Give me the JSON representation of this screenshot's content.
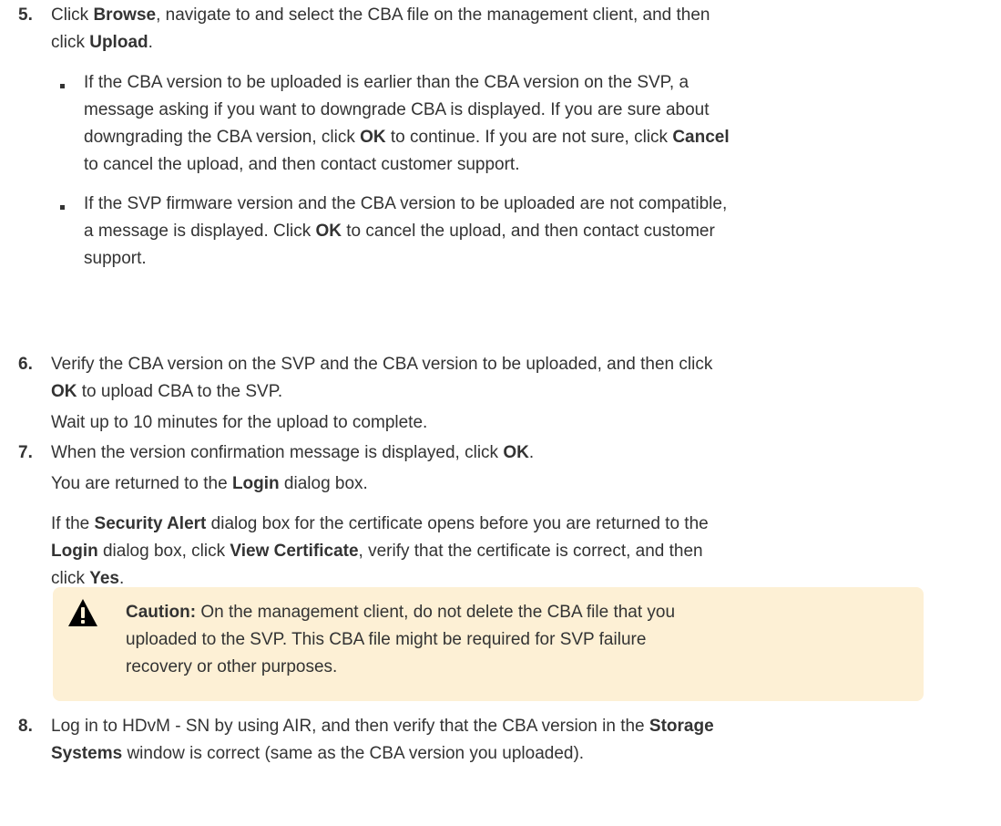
{
  "steps": [
    {
      "number": "5.",
      "lines": [
        [
          "Click ",
          {
            "b": "Browse"
          },
          ", navigate to and select the CBA file on the management client, and then"
        ],
        [
          "click ",
          {
            "b": "Upload"
          },
          "."
        ]
      ],
      "bullets": [
        [
          [
            "If the CBA version to be uploaded is earlier than the CBA version on the SVP, a"
          ],
          [
            "message asking if you want to downgrade CBA is displayed. If you are sure about"
          ],
          [
            "downgrading the CBA version, click ",
            {
              "b": "OK"
            },
            " to continue. If you are not sure, click ",
            {
              "b": "Cancel"
            }
          ],
          [
            "to cancel the upload, and then contact customer support."
          ]
        ],
        [
          [
            "If the SVP firmware version and the CBA version to be uploaded are not compatible,"
          ],
          [
            "a message is displayed. Click ",
            {
              "b": "OK"
            },
            " to cancel the upload, and then contact customer"
          ],
          [
            "support."
          ]
        ]
      ]
    },
    {
      "number": "6.",
      "lines": [
        [
          "Verify the CBA version on the SVP and the CBA version to be uploaded, and then click"
        ],
        [
          {
            "b": "OK"
          },
          " to upload CBA to the SVP."
        ]
      ],
      "note_lines": [
        [
          "Wait up to 10 minutes for the upload to complete."
        ]
      ]
    },
    {
      "number": "7.",
      "lines": [
        [
          "When the version confirmation message is displayed, click ",
          {
            "b": "OK"
          },
          "."
        ]
      ],
      "note_lines": [
        [
          "You are returned to the ",
          {
            "b": "Login"
          },
          " dialog box."
        ]
      ],
      "para_lines": [
        [
          "If the ",
          {
            "b": "Security Alert"
          },
          " dialog box for the certificate opens before you are returned to the"
        ],
        [
          {
            "b": "Login"
          },
          " dialog box, click ",
          {
            "b": "View Certificate"
          },
          ", verify that the certificate is correct, and then"
        ],
        [
          "click ",
          {
            "b": "Yes"
          },
          "."
        ]
      ]
    },
    {
      "number": "8.",
      "lines": [
        [
          "Log in to HDvM - SN by using AIR, and then verify that the CBA version in the ",
          {
            "b": "Storage"
          }
        ],
        [
          {
            "b": "Systems"
          },
          " window is correct (same as the CBA version you uploaded)."
        ]
      ]
    }
  ],
  "caution": {
    "icon": "warning-icon",
    "label": "Caution:",
    "lines": [
      " On the management client, do not delete the CBA file that you",
      "uploaded to the SVP. This CBA file might be required for SVP failure",
      "recovery or other purposes."
    ],
    "background_color": "#fdf0d5",
    "icon_color": "#000000"
  }
}
